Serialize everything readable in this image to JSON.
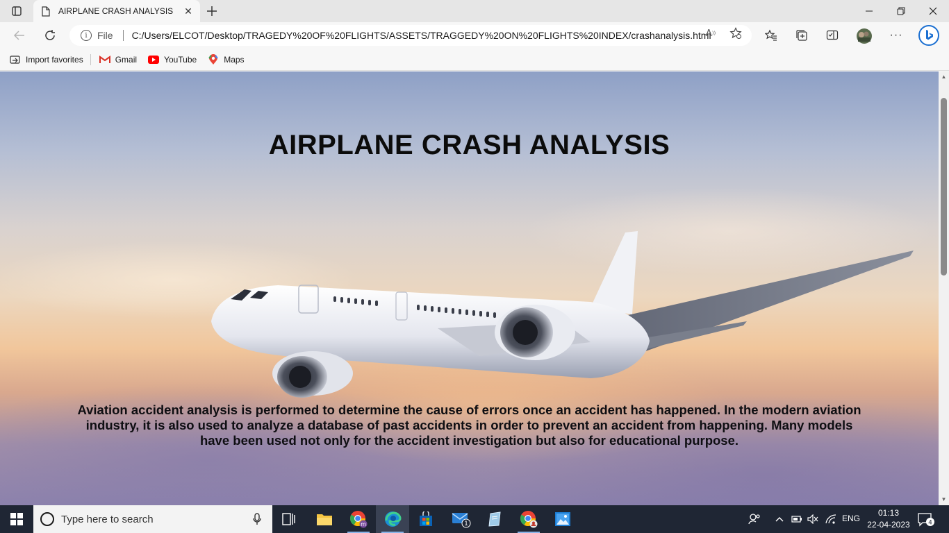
{
  "browser": {
    "tab_title": "AIRPLANE CRASH ANALYSIS",
    "address": {
      "scheme_label": "File",
      "url": "C:/Users/ELCOT/Desktop/TRAGEDY%20OF%20FLIGHTS/ASSETS/TRAGGEDY%20ON%20FLIGHTS%20INDEX/crashanalysis.html"
    },
    "favorites": [
      {
        "label": "Import favorites",
        "icon": "import-icon"
      },
      {
        "label": "Gmail",
        "icon": "gmail-icon"
      },
      {
        "label": "YouTube",
        "icon": "youtube-icon"
      },
      {
        "label": "Maps",
        "icon": "maps-icon"
      }
    ]
  },
  "page": {
    "title": "AIRPLANE CRASH ANALYSIS",
    "description": "Aviation accident analysis is performed to determine the cause of errors once an accident has happened. In the modern aviation industry, it is also used to analyze a database of past accidents in order to prevent an accident from happening. Many models have been used not only for the accident investigation but also for educational purpose."
  },
  "taskbar": {
    "search_placeholder": "Type here to search",
    "mail_badge": "1",
    "language": "ENG",
    "time": "01:13",
    "date": "22-04-2023",
    "notification_count": "4"
  },
  "colors": {
    "taskbar_bg": "#1f2634",
    "accent": "#0078d4"
  }
}
